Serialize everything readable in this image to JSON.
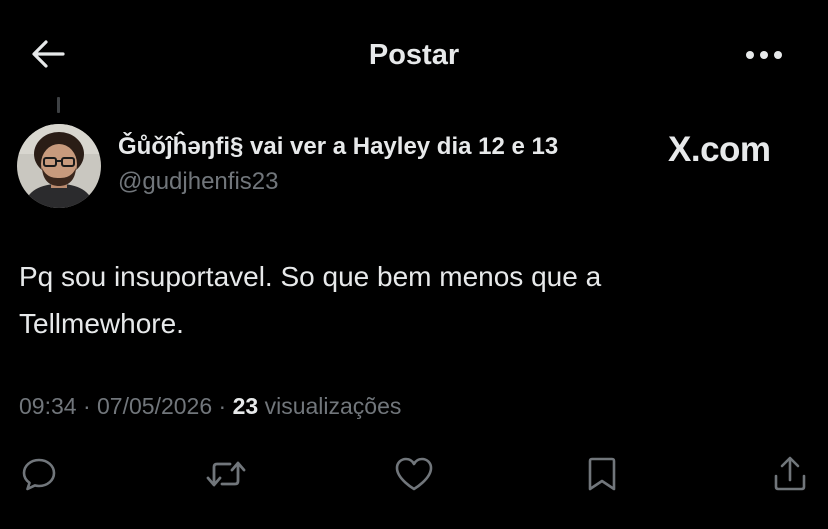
{
  "header": {
    "title": "Postar",
    "back_icon": "arrow-left-icon",
    "more_icon": "more-horizontal-icon"
  },
  "post": {
    "author": {
      "display_name": "Ǧůǒĵĥəŋfi§ vai ver a Hayley dia 12 e 13",
      "handle": "@gudjhenfis23"
    },
    "watermark": "X.com",
    "text": "Pq sou insuportavel. So que bem menos que a\nTellmewhore.",
    "time": "09:34",
    "separator": "·",
    "date": "07/05/2026",
    "views_count": "23",
    "views_label": "visualizações"
  },
  "actions": [
    {
      "name": "reply",
      "icon": "comment-icon"
    },
    {
      "name": "repost",
      "icon": "repost-icon"
    },
    {
      "name": "like",
      "icon": "heart-icon"
    },
    {
      "name": "bookmark",
      "icon": "bookmark-icon"
    },
    {
      "name": "share",
      "icon": "share-icon"
    }
  ],
  "colors": {
    "background": "#000000",
    "primary_text": "#e7e9ea",
    "secondary_text": "#71767b"
  }
}
